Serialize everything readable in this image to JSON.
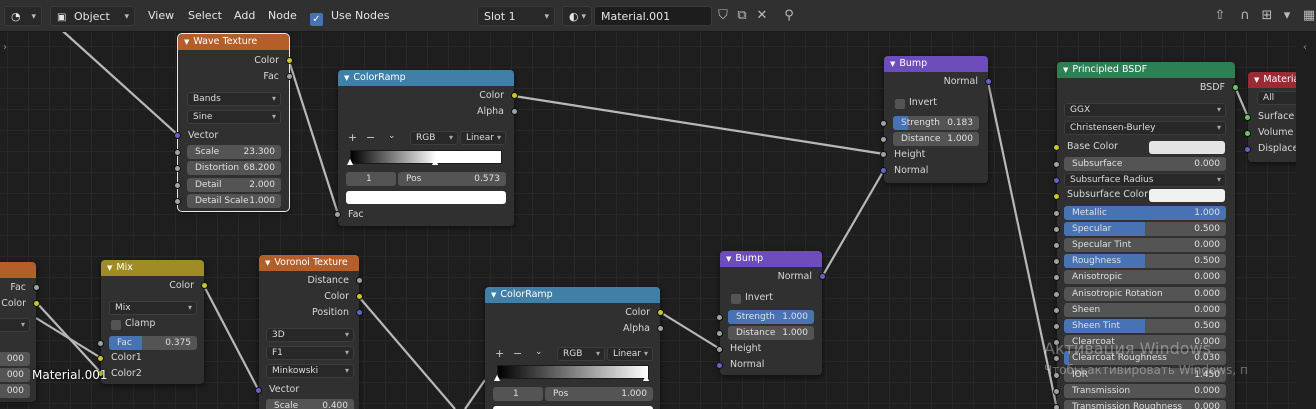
{
  "header": {
    "mode": "Object",
    "menu": [
      "View",
      "Select",
      "Add",
      "Node"
    ],
    "use_nodes_label": "Use Nodes",
    "slot": "Slot 1",
    "material": "Material.001"
  },
  "nodes": {
    "wave": {
      "title": "Wave Texture",
      "out_color": "Color",
      "out_fac": "Fac",
      "type": "Bands",
      "profile": "Sine",
      "in_vector": "Vector",
      "scale_label": "Scale",
      "scale_value": "23.300",
      "distortion_label": "Distortion",
      "distortion_value": "68.200",
      "detail_label": "Detail",
      "detail_value": "2.000",
      "detail_scale_label": "Detail Scale",
      "detail_scale_value": "1.000"
    },
    "ramp1": {
      "title": "ColorRamp",
      "out_color": "Color",
      "out_alpha": "Alpha",
      "color_mode": "RGB",
      "interpolation": "Linear",
      "index": "1",
      "pos_label": "Pos",
      "pos_value": "0.573",
      "in_fac": "Fac"
    },
    "bump1": {
      "title": "Bump",
      "out_normal": "Normal",
      "invert": "Invert",
      "strength_label": "Strength",
      "strength_value": "0.183",
      "distance_label": "Distance",
      "distance_value": "1.000",
      "in_height": "Height",
      "in_normal": "Normal"
    },
    "bsdf": {
      "title": "Principled BSDF",
      "out_bsdf": "BSDF",
      "distribution": "GGX",
      "subsurface_method": "Christensen-Burley",
      "base_color": "Base Color",
      "rows": [
        {
          "label": "Subsurface",
          "value": "0.000",
          "fill": 0
        },
        {
          "label": "Subsurface Radius",
          "value": "",
          "fill": 0
        },
        {
          "label": "Subsurface Color",
          "value": "",
          "fill": 0
        },
        {
          "label": "Metallic",
          "value": "1.000",
          "fill": 1
        },
        {
          "label": "Specular",
          "value": "0.500",
          "fill": 0.5
        },
        {
          "label": "Specular Tint",
          "value": "0.000",
          "fill": 0
        },
        {
          "label": "Roughness",
          "value": "0.500",
          "fill": 0.5
        },
        {
          "label": "Anisotropic",
          "value": "0.000",
          "fill": 0
        },
        {
          "label": "Anisotropic Rotation",
          "value": "0.000",
          "fill": 0
        },
        {
          "label": "Sheen",
          "value": "0.000",
          "fill": 0
        },
        {
          "label": "Sheen Tint",
          "value": "0.500",
          "fill": 0.5
        },
        {
          "label": "Clearcoat",
          "value": "0.000",
          "fill": 0
        },
        {
          "label": "Clearcoat Roughness",
          "value": "0.030",
          "fill": 0.03
        },
        {
          "label": "IOR",
          "value": "1.450",
          "fill": 0
        },
        {
          "label": "Transmission",
          "value": "0.000",
          "fill": 0
        },
        {
          "label": "Transmission Roughness",
          "value": "0.000",
          "fill": 0
        }
      ]
    },
    "output": {
      "title": "Material",
      "target": "All",
      "in_surface": "Surface",
      "in_volume": "Volume",
      "in_displacement": "Displace"
    },
    "left": {
      "out_fac": "Fac",
      "out_color": "Color",
      "v1": "000",
      "v2": "000",
      "v3": "000",
      "material_label": "Material.001"
    },
    "mix": {
      "title": "Mix",
      "out_color": "Color",
      "blend": "Mix",
      "clamp": "Clamp",
      "fac_label": "Fac",
      "fac_value": "0.375",
      "in_color1": "Color1",
      "in_color2": "Color2"
    },
    "voronoi": {
      "title": "Voronoi Texture",
      "out_distance": "Distance",
      "out_color": "Color",
      "out_position": "Position",
      "dimensions": "3D",
      "feature": "F1",
      "metric": "Minkowski",
      "in_vector": "Vector",
      "scale_label": "Scale",
      "scale_value": "0.400"
    },
    "ramp2": {
      "title": "ColorRamp",
      "out_color": "Color",
      "out_alpha": "Alpha",
      "color_mode": "RGB",
      "interpolation": "Linear",
      "index": "1",
      "pos_label": "Pos",
      "pos_value": "1.000"
    },
    "bump2": {
      "title": "Bump",
      "out_normal": "Normal",
      "invert": "Invert",
      "strength_label": "Strength",
      "strength_value": "1.000",
      "distance_label": "Distance",
      "distance_value": "1.000",
      "in_height": "Height",
      "in_normal": "Normal"
    }
  },
  "watermark": {
    "line1": "Активация Windows",
    "line2": "Чтобы активировать Windows, п"
  }
}
